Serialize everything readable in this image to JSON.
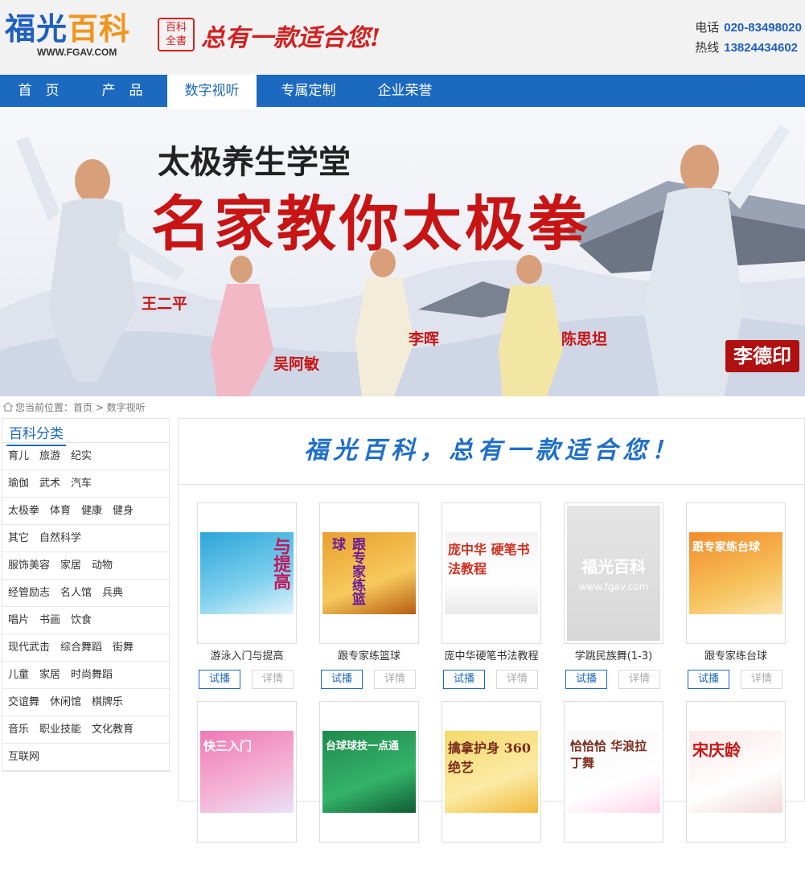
{
  "header": {
    "logo_text_a": "福光",
    "logo_text_b": "百科",
    "logo_url": "WWW.FGAV.COM",
    "seal_text_top": "百科",
    "seal_text_bottom": "全書",
    "slogan": "总有一款适合您!",
    "phone_label": "电话",
    "phone": "020-83498020",
    "hotline_label": "热线",
    "hotline": "13824434602"
  },
  "nav": {
    "items": [
      {
        "label": "首　页"
      },
      {
        "label": "产　品"
      },
      {
        "label": "数字视听",
        "active": true
      },
      {
        "label": "专属定制"
      },
      {
        "label": "企业荣誉"
      }
    ]
  },
  "banner": {
    "subtitle": "太极养生学堂",
    "title": "名家教你太极拳",
    "names": [
      "王二平",
      "吴阿敏",
      "李晖",
      "陈思坦"
    ],
    "tag": "李德印"
  },
  "breadcrumb": {
    "text": "您当前位置：首页 > 数字视听"
  },
  "sidebar": {
    "title": "百科分类",
    "rows": [
      [
        "育儿",
        "旅游",
        "纪实"
      ],
      [
        "瑜伽",
        "武术",
        "汽车"
      ],
      [
        "太极拳",
        "体育",
        "健康",
        "健身"
      ],
      [
        "其它",
        "自然科学"
      ],
      [
        "服饰美容",
        "家居",
        "动物"
      ],
      [
        "经管励志",
        "名人馆",
        "兵典"
      ],
      [
        "唱片",
        "书画",
        "饮食"
      ],
      [
        "现代武击",
        "综合舞蹈",
        "街舞"
      ],
      [
        "儿童",
        "家居",
        "时尚舞蹈"
      ],
      [
        "交谊舞",
        "休闲馆",
        "棋牌乐"
      ],
      [
        "音乐",
        "职业技能",
        "文化教育"
      ],
      [
        "互联网"
      ]
    ]
  },
  "main": {
    "slogan": "福光百科，总有一款适合您！",
    "play_label": "试播",
    "detail_label": "详情",
    "products": [
      {
        "title": "游泳入门与提高",
        "cover": "游泳入门与提高"
      },
      {
        "title": "跟专家练篮球",
        "cover": "跟专家练篮球"
      },
      {
        "title": "庞中华硬笔书法教程",
        "cover": "庞中华 硬笔书法教程"
      },
      {
        "title": "学跳民族舞(1-3)",
        "cover": "福光百科",
        "cover_sub": "www.fgav.com"
      },
      {
        "title": "跟专家练台球",
        "cover": "跟专家练台球"
      },
      {
        "title": "",
        "cover": "快三入门"
      },
      {
        "title": "",
        "cover": "台球球技一点通"
      },
      {
        "title": "",
        "cover": "擒拿护身 360绝艺"
      },
      {
        "title": "",
        "cover": "恰恰恰 华浪拉丁舞"
      },
      {
        "title": "",
        "cover": "宋庆龄"
      }
    ]
  },
  "colors": {
    "brand_blue": "#1c69c0",
    "accent_red": "#c81414",
    "accent_orange": "#f0951c"
  }
}
